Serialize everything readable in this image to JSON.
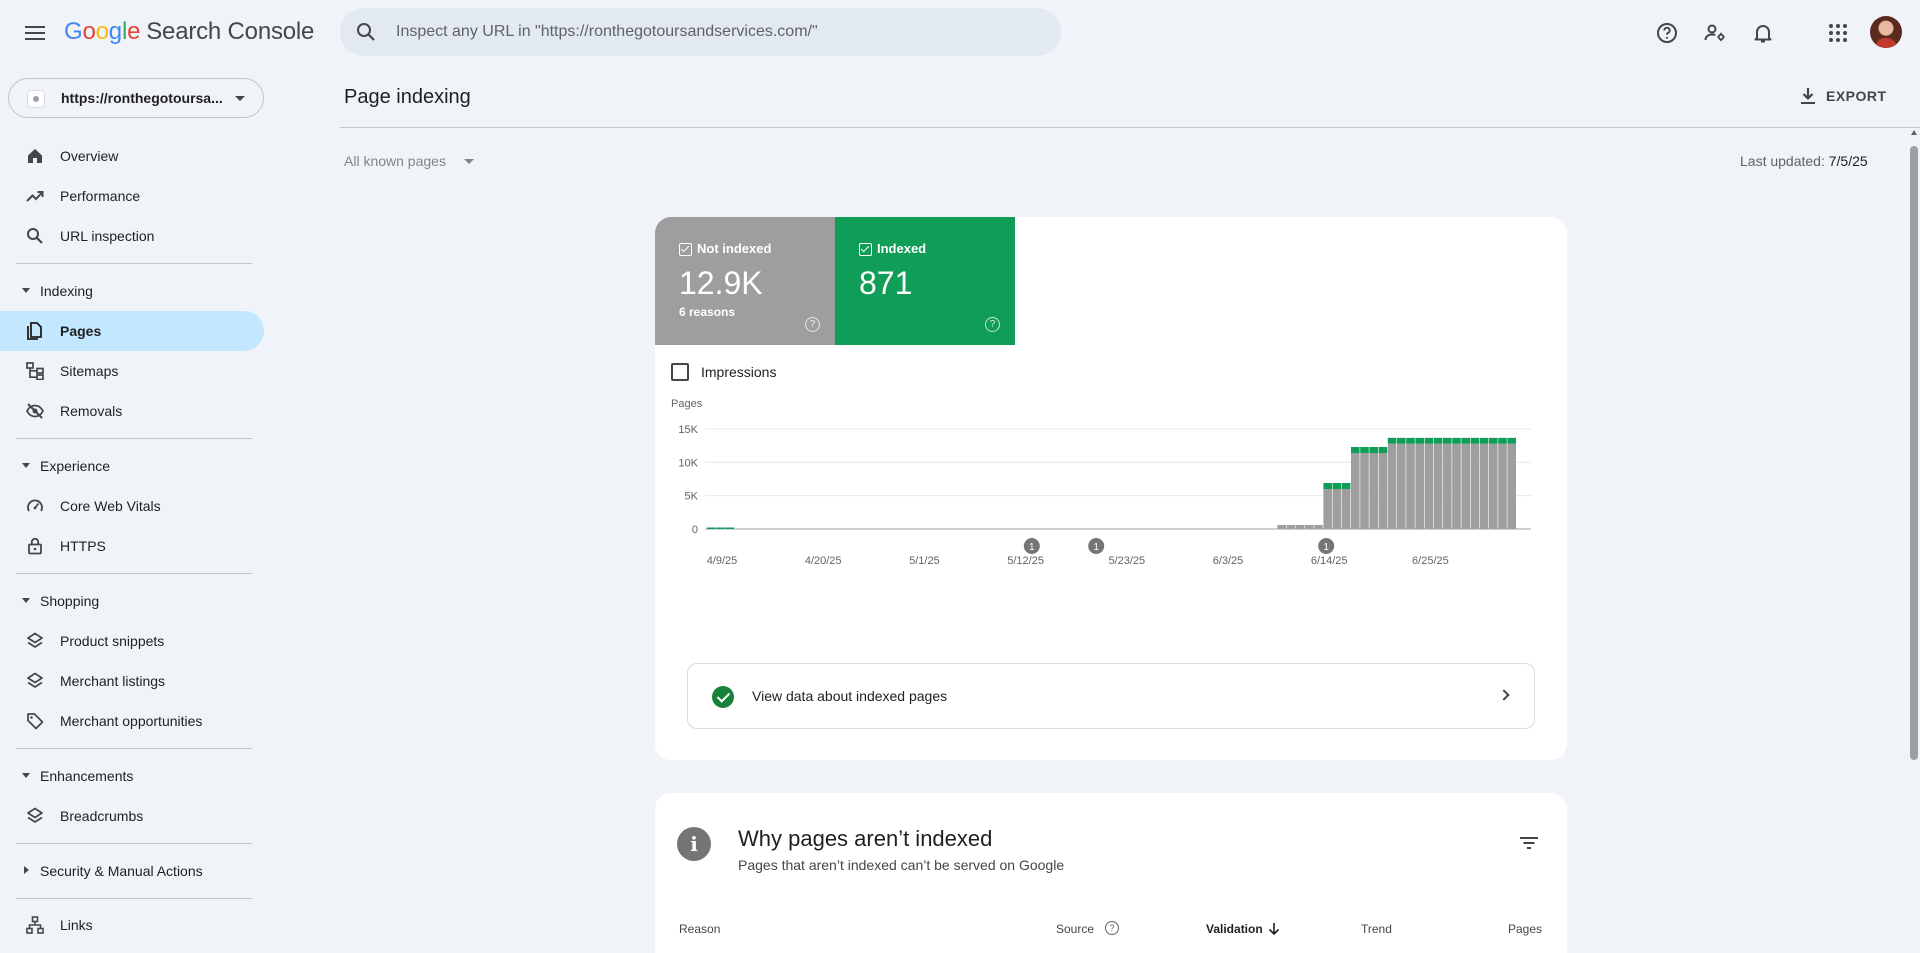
{
  "app": {
    "brand_letters": [
      "G",
      "o",
      "o",
      "g",
      "l",
      "e"
    ],
    "brand_rest": "Search Console"
  },
  "search": {
    "placeholder": "Inspect any URL in \"https://ronthegotoursandservices.com/\""
  },
  "property": {
    "label": "https://ronthegotoursa..."
  },
  "nav": {
    "overview": "Overview",
    "performance": "Performance",
    "url_inspection": "URL inspection",
    "indexing": "Indexing",
    "pages": "Pages",
    "sitemaps": "Sitemaps",
    "removals": "Removals",
    "experience": "Experience",
    "core_web_vitals": "Core Web Vitals",
    "https": "HTTPS",
    "shopping": "Shopping",
    "product_snippets": "Product snippets",
    "merchant_listings": "Merchant listings",
    "merchant_opportunities": "Merchant opportunities",
    "enhancements": "Enhancements",
    "breadcrumbs": "Breadcrumbs",
    "security": "Security & Manual Actions",
    "links": "Links"
  },
  "header": {
    "title": "Page indexing",
    "export_label": "EXPORT",
    "filter_label": "All known pages",
    "last_updated_prefix": "Last updated:",
    "last_updated_value": "7/5/25"
  },
  "tiles": {
    "not_indexed": {
      "label": "Not indexed",
      "value": "12.9K",
      "sub": "6 reasons",
      "help": "?"
    },
    "indexed": {
      "label": "Indexed",
      "value": "871",
      "help": "?"
    }
  },
  "impressions_label": "Impressions",
  "chart_data": {
    "type": "bar",
    "stacked": true,
    "ylabel": "Pages",
    "ylim": [
      0,
      15000
    ],
    "yticks": [
      {
        "value": 0,
        "label": "0"
      },
      {
        "value": 5000,
        "label": "5K"
      },
      {
        "value": 10000,
        "label": "10K"
      },
      {
        "value": 15000,
        "label": "15K"
      }
    ],
    "xtick_labels": [
      {
        "day": 0,
        "label": "4/9/25"
      },
      {
        "day": 11,
        "label": "4/20/25"
      },
      {
        "day": 22,
        "label": "5/1/25"
      },
      {
        "day": 33,
        "label": "5/12/25"
      },
      {
        "day": 44,
        "label": "5/23/25"
      },
      {
        "day": 55,
        "label": "6/3/25"
      },
      {
        "day": 66,
        "label": "6/14/25"
      },
      {
        "day": 77,
        "label": "6/25/25"
      }
    ],
    "annotations": [
      {
        "day": 34,
        "label": "1"
      },
      {
        "day": 41,
        "label": "1"
      },
      {
        "day": 66,
        "label": "1"
      }
    ],
    "colors": {
      "not_indexed": "#9e9e9e",
      "indexed": "#0f9d58"
    },
    "days": 88,
    "series": [
      {
        "name": "Not indexed",
        "values": [
          0,
          0,
          0,
          0,
          0,
          0,
          0,
          0,
          0,
          0,
          0,
          0,
          0,
          0,
          0,
          0,
          0,
          0,
          0,
          0,
          0,
          0,
          0,
          0,
          0,
          0,
          0,
          0,
          0,
          0,
          0,
          0,
          0,
          0,
          0,
          0,
          0,
          0,
          0,
          0,
          0,
          0,
          0,
          0,
          0,
          0,
          0,
          0,
          0,
          0,
          0,
          0,
          0,
          0,
          0,
          0,
          0,
          0,
          0,
          0,
          0,
          0,
          600,
          600,
          600,
          600,
          600,
          6000,
          6000,
          6000,
          11400,
          11400,
          11400,
          11400,
          12800,
          12800,
          12800,
          12800,
          12800,
          12800,
          12800,
          12800,
          12800,
          12800,
          12800,
          12800,
          12800,
          12800
        ]
      },
      {
        "name": "Indexed",
        "values": [
          150,
          150,
          150,
          0,
          0,
          0,
          0,
          0,
          0,
          0,
          0,
          0,
          0,
          0,
          0,
          0,
          0,
          0,
          0,
          0,
          0,
          0,
          0,
          0,
          0,
          0,
          0,
          0,
          0,
          0,
          0,
          0,
          0,
          0,
          0,
          0,
          0,
          0,
          0,
          0,
          0,
          0,
          0,
          0,
          0,
          0,
          0,
          0,
          0,
          0,
          0,
          0,
          0,
          0,
          0,
          0,
          0,
          0,
          0,
          0,
          0,
          0,
          0,
          0,
          0,
          0,
          0,
          900,
          900,
          900,
          900,
          900,
          900,
          900,
          871,
          871,
          871,
          871,
          871,
          871,
          871,
          871,
          871,
          871,
          871,
          871,
          871,
          871
        ]
      }
    ]
  },
  "view_indexed_label": "View data about indexed pages",
  "why": {
    "title": "Why pages aren’t indexed",
    "subtitle": "Pages that aren’t indexed can’t be served on Google",
    "col_reason": "Reason",
    "col_source": "Source",
    "col_validation": "Validation",
    "col_trend": "Trend",
    "col_pages": "Pages"
  }
}
